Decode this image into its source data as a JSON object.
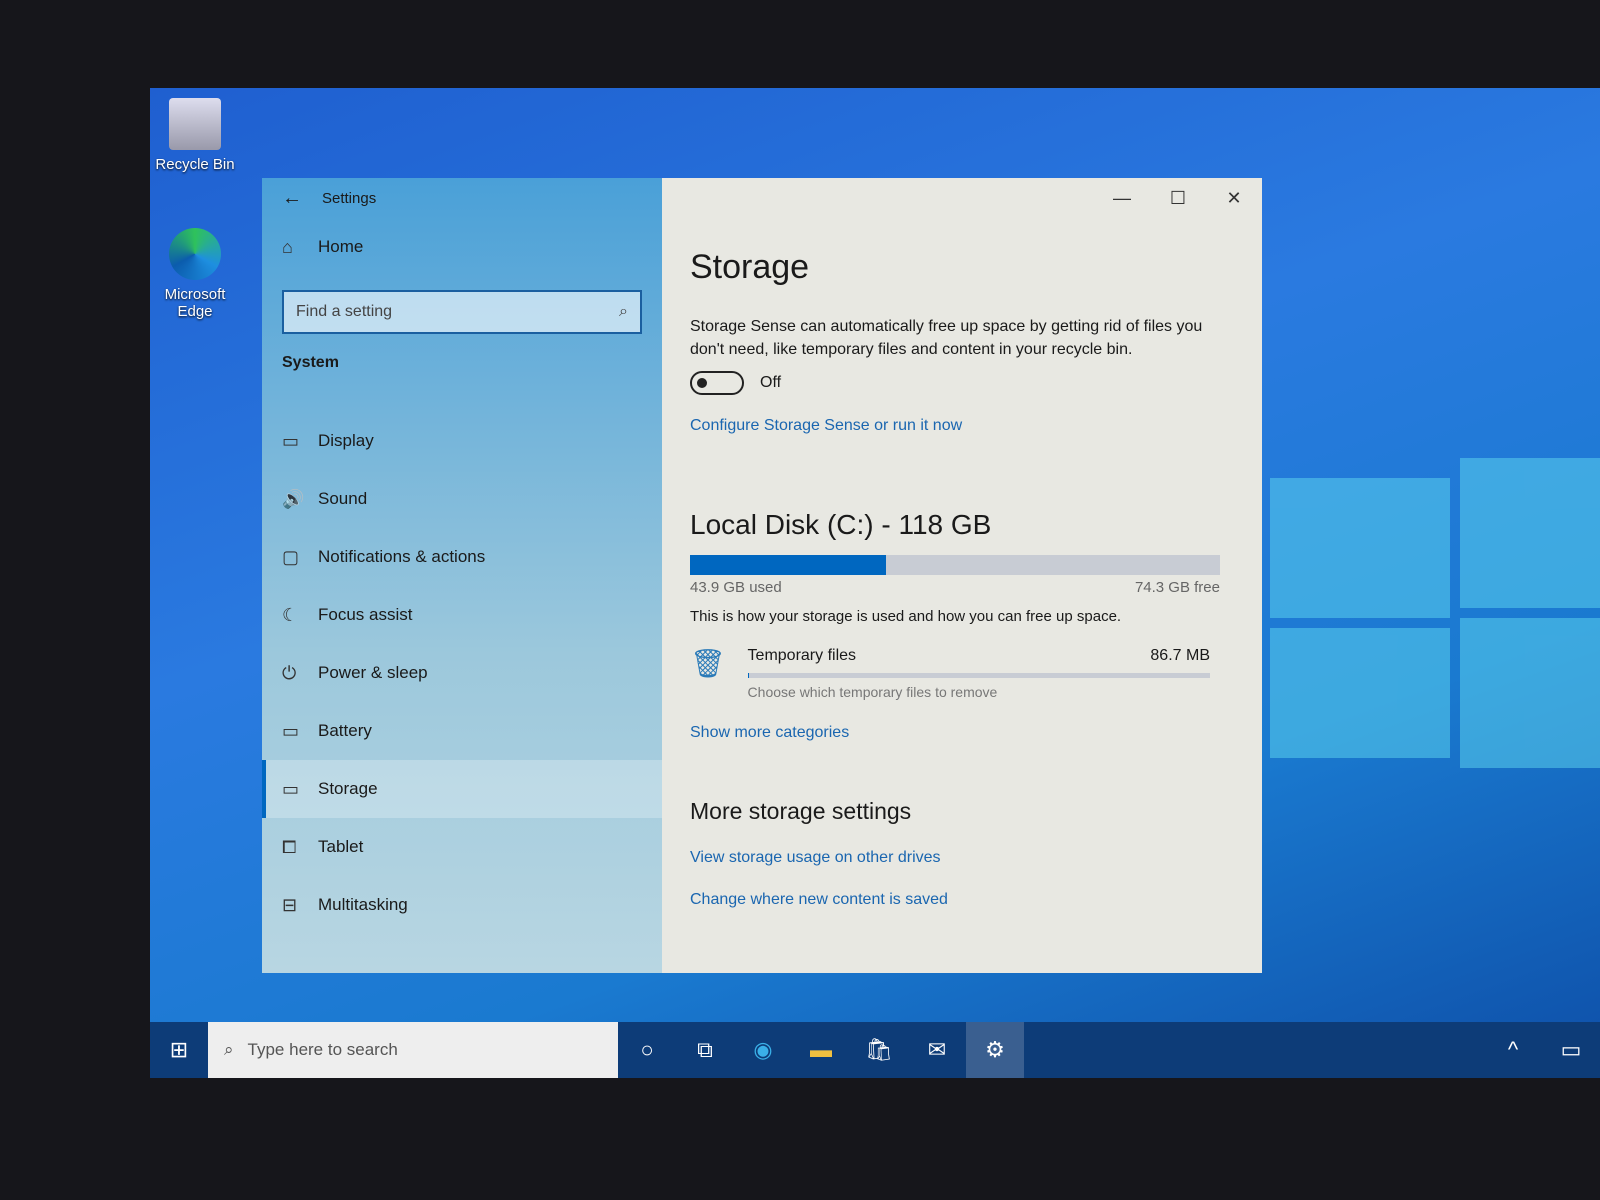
{
  "desktop": {
    "icons": [
      {
        "label": "Recycle Bin"
      },
      {
        "label": "Microsoft Edge"
      }
    ]
  },
  "settings": {
    "title": "Settings",
    "home": "Home",
    "search_placeholder": "Find a setting",
    "section": "System",
    "nav": [
      {
        "label": "Display",
        "icon": "monitor-icon"
      },
      {
        "label": "Sound",
        "icon": "speaker-icon"
      },
      {
        "label": "Notifications & actions",
        "icon": "notification-icon"
      },
      {
        "label": "Focus assist",
        "icon": "moon-icon"
      },
      {
        "label": "Power & sleep",
        "icon": "power-icon"
      },
      {
        "label": "Battery",
        "icon": "battery-icon"
      },
      {
        "label": "Storage",
        "icon": "storage-icon",
        "selected": true
      },
      {
        "label": "Tablet",
        "icon": "tablet-icon"
      },
      {
        "label": "Multitasking",
        "icon": "multitasking-icon"
      }
    ]
  },
  "storage": {
    "title": "Storage",
    "description": "Storage Sense can automatically free up space by getting rid of files you don't need, like temporary files and content in your recycle bin.",
    "toggle_state": "Off",
    "configure_link": "Configure Storage Sense or run it now",
    "disk_title": "Local Disk (C:) - 118 GB",
    "used": "43.9 GB used",
    "free": "74.3 GB free",
    "used_fraction": 0.37,
    "usage_description": "This is how your storage is used and how you can free up space.",
    "category": {
      "name": "Temporary files",
      "size": "86.7 MB",
      "hint": "Choose which temporary files to remove",
      "fraction": 0.002
    },
    "show_more": "Show more categories",
    "more_title": "More storage settings",
    "more_links": [
      "View storage usage on other drives",
      "Change where new content is saved"
    ]
  },
  "taskbar": {
    "search_placeholder": "Type here to search"
  },
  "colors": {
    "accent": "#0067c0",
    "bar_bg": "#c8ccd4"
  }
}
